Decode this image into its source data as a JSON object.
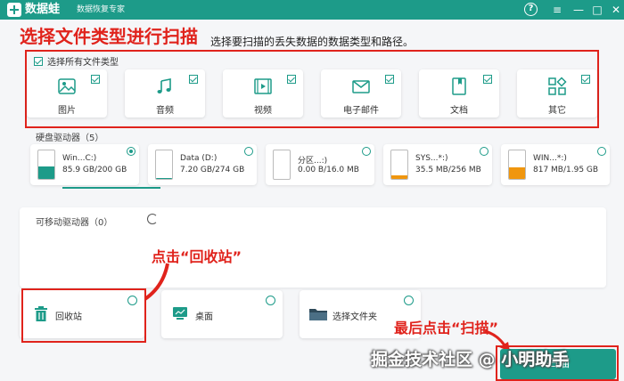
{
  "titlebar": {
    "app_name": "数据蛙",
    "subtitle": "数据恢复专家",
    "help": "?",
    "menu": "≡",
    "minimize": "—",
    "maximize": "□",
    "close": "✕"
  },
  "annotations": {
    "step1": "选择文件类型进行扫描",
    "step2": "点击“回收站”",
    "step3": "最后点击“扫描”"
  },
  "instruction": "选择要扫描的丢失数据的数据类型和路径。",
  "file_types": {
    "select_all_label": "选择所有文件类型",
    "select_all_checked": true,
    "items": [
      {
        "label": "图片",
        "icon": "image-icon",
        "checked": true
      },
      {
        "label": "音频",
        "icon": "music-note-icon",
        "checked": true
      },
      {
        "label": "视频",
        "icon": "video-icon",
        "checked": true
      },
      {
        "label": "电子邮件",
        "icon": "email-icon",
        "checked": true
      },
      {
        "label": "文档",
        "icon": "document-icon",
        "checked": true
      },
      {
        "label": "其它",
        "icon": "other-shapes-icon",
        "checked": true
      }
    ]
  },
  "hard_drives": {
    "title": "硬盘驱动器（5）",
    "items": [
      {
        "name": "Win...C:)",
        "size": "85.9 GB/200 GB",
        "selected": true,
        "used_fraction": 0.43,
        "fill": "#1d9b89"
      },
      {
        "name": "Data (D:)",
        "size": "7.20 GB/274 GB",
        "selected": false,
        "used_fraction": 0.03,
        "fill": "#1d9b89"
      },
      {
        "name": "分区...:)",
        "size": "0.00  B/16.0 MB",
        "selected": false,
        "used_fraction": 0.0,
        "fill": "#1d9b89"
      },
      {
        "name": "SYS...*:)",
        "size": "35.5 MB/256 MB",
        "selected": false,
        "used_fraction": 0.14,
        "fill": "#f0960e"
      },
      {
        "name": "WIN...*:)",
        "size": "817 MB/1.95 GB",
        "selected": false,
        "used_fraction": 0.42,
        "fill": "#f0960e"
      }
    ]
  },
  "removable": {
    "title": "可移动驱动器（0）"
  },
  "locations": [
    {
      "label": "回收站",
      "icon": "trash-icon"
    },
    {
      "label": "桌面",
      "icon": "desktop-icon"
    },
    {
      "label": "选择文件夹",
      "icon": "folder-icon"
    }
  ],
  "scan_button": "扫描",
  "watermark": "掘金技术社区 @ 小明助手",
  "colors": {
    "accent": "#1d9b89",
    "annotation": "#e0231c",
    "orange": "#f0960e"
  }
}
